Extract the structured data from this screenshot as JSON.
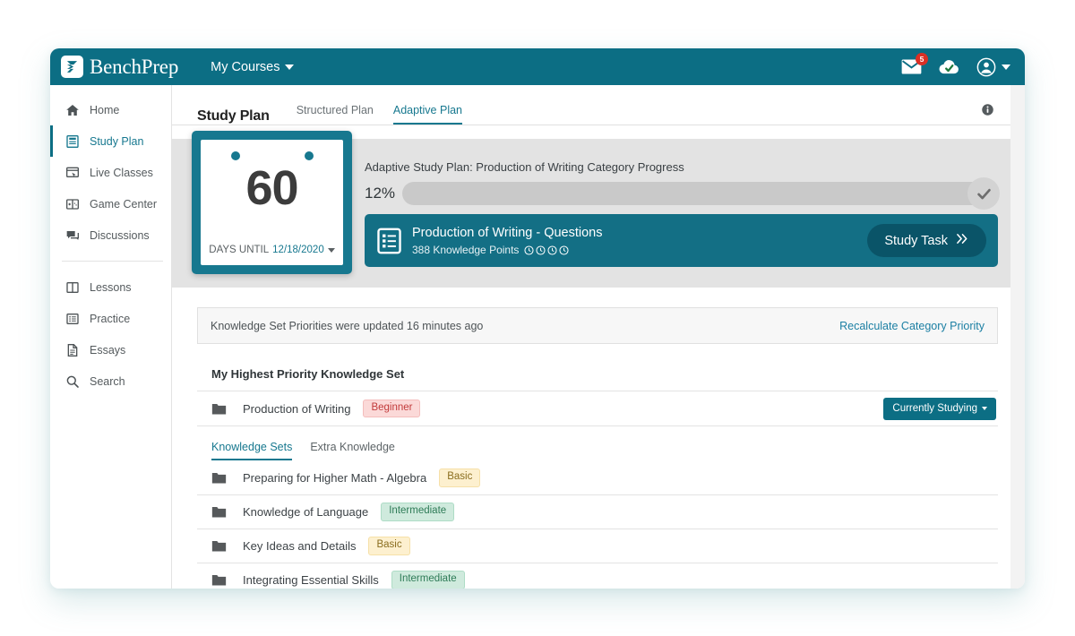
{
  "topbar": {
    "brand": "BenchPrep",
    "brand_icon": "benchprep-logo-icon",
    "my_courses": "My Courses",
    "mail_icon": "envelope-icon",
    "mail_badge": "5",
    "sync_icon": "cloud-check-icon",
    "avatar_icon": "user-avatar-icon"
  },
  "sidebar": {
    "items": [
      {
        "label": "Home",
        "icon": "home-icon",
        "active": false
      },
      {
        "label": "Study Plan",
        "icon": "study-plan-icon",
        "active": true
      },
      {
        "label": "Live Classes",
        "icon": "live-classes-icon",
        "active": false
      },
      {
        "label": "Game Center",
        "icon": "game-center-icon",
        "active": false
      },
      {
        "label": "Discussions",
        "icon": "discussions-icon",
        "active": false
      },
      {
        "label": "Lessons",
        "icon": "lessons-icon",
        "active": false
      },
      {
        "label": "Practice",
        "icon": "practice-icon",
        "active": false
      },
      {
        "label": "Essays",
        "icon": "essays-icon",
        "active": false
      },
      {
        "label": "Search",
        "icon": "search-icon",
        "active": false
      }
    ]
  },
  "content": {
    "page_title": "Study Plan",
    "tabs": [
      {
        "label": "Structured Plan",
        "active": false
      },
      {
        "label": "Adaptive Plan",
        "active": true
      }
    ],
    "info_icon": "info-icon"
  },
  "countdown": {
    "days": "60",
    "prefix": "DAYS UNTIL",
    "date": "12/18/2020",
    "dropdown_icon": "chevron-down-icon"
  },
  "progress": {
    "label": "Adaptive Study Plan: Production of Writing Category Progress",
    "percent_text": "12%",
    "percent_value": 12,
    "fill_color": "#f0b800",
    "track_color": "#c9c9c9",
    "complete_icon": "check-icon"
  },
  "task_card": {
    "icon": "task-list-icon",
    "title": "Production of Writing - Questions",
    "subtitle": "388 Knowledge Points",
    "point_icons": [
      "clock-icon",
      "clock-icon",
      "clock-icon",
      "clock-icon"
    ],
    "button_label": "Study Task",
    "button_icon": "double-chevron-right-icon",
    "accent_color": "#136f85"
  },
  "notice": {
    "text": "Knowledge Set Priorities were updated 16 minutes ago",
    "link": "Recalculate Category Priority"
  },
  "highest_priority": {
    "section_title": "My Highest Priority Knowledge Set",
    "row": {
      "icon": "folder-icon",
      "name": "Production of Writing",
      "badge": "Beginner",
      "badge_type": "beginner",
      "action_label": "Currently Studying",
      "action_icon": "chevron-down-icon"
    }
  },
  "knowledge_tabs": [
    {
      "label": "Knowledge Sets",
      "active": true
    },
    {
      "label": "Extra Knowledge",
      "active": false
    }
  ],
  "knowledge_sets": [
    {
      "icon": "folder-icon",
      "name": "Preparing for Higher Math - Algebra",
      "badge": "Basic",
      "badge_type": "basic"
    },
    {
      "icon": "folder-icon",
      "name": "Knowledge of Language",
      "badge": "Intermediate",
      "badge_type": "intermediate"
    },
    {
      "icon": "folder-icon",
      "name": "Key Ideas and Details",
      "badge": "Basic",
      "badge_type": "basic"
    },
    {
      "icon": "folder-icon",
      "name": "Integrating Essential Skills",
      "badge": "Intermediate",
      "badge_type": "intermediate"
    }
  ],
  "theme": {
    "primary": "#0c6e84",
    "primary_light": "#17788f",
    "link": "#1b7fa3",
    "badge_red": "#d93025"
  }
}
